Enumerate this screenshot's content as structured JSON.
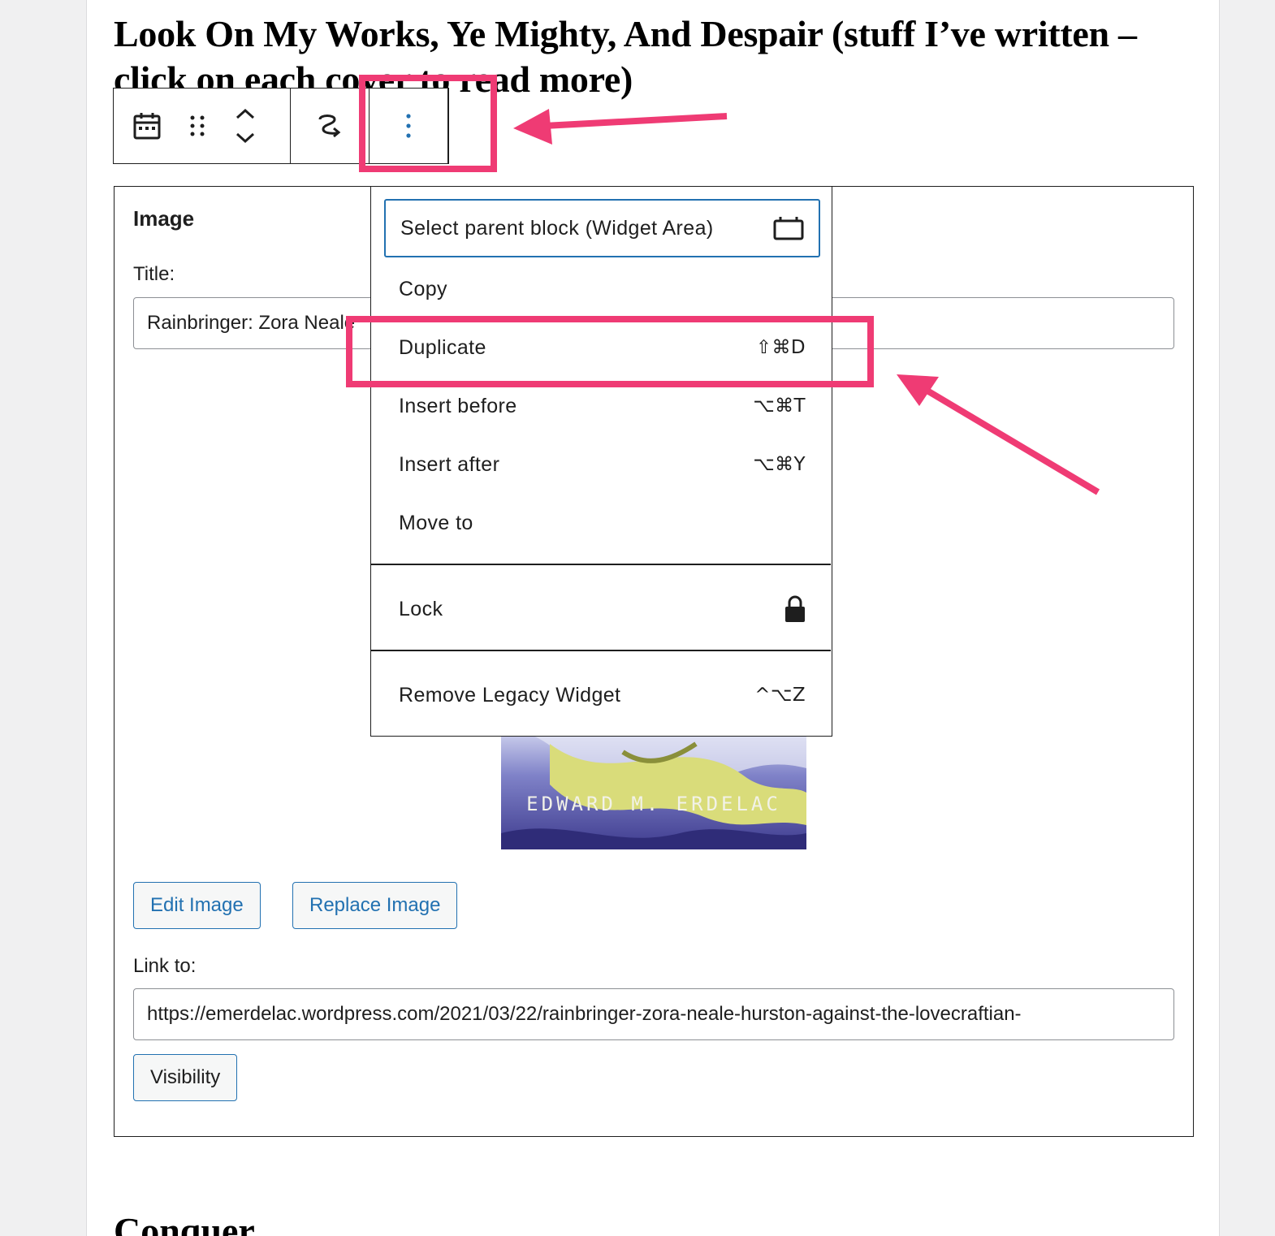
{
  "page": {
    "heading": "Look On My Works, Ye Mighty, And Despair (stuff I’ve written – click on each cover to read more)",
    "next_heading": "Conquer"
  },
  "toolbar": {
    "icons": [
      "calendar-icon",
      "drag-handle-icon",
      "move-up-icon",
      "move-down-icon",
      "transform-icon",
      "options-icon"
    ]
  },
  "widget": {
    "title": "Image",
    "title_label": "Title:",
    "title_value": "Rainbringer: Zora Neale",
    "cover_author": "EDWARD M. ERDELAC",
    "edit_button": "Edit Image",
    "replace_button": "Replace Image",
    "link_label": "Link to:",
    "link_value": "https://emerdelac.wordpress.com/2021/03/22/rainbringer-zora-neale-hurston-against-the-lovecraftian-",
    "visibility_button": "Visibility"
  },
  "menu": {
    "select_parent": "Select parent block (Widget Area)",
    "copy": "Copy",
    "duplicate": "Duplicate",
    "duplicate_shortcut": "⇧⌘D",
    "insert_before": "Insert before",
    "insert_before_shortcut": "⌥⌘T",
    "insert_after": "Insert after",
    "insert_after_shortcut": "⌥⌘Y",
    "move_to": "Move to",
    "lock": "Lock",
    "remove": "Remove Legacy Widget",
    "remove_shortcut": "^⌥Z"
  },
  "colors": {
    "accent": "#2271b1",
    "annotation": "#ef3b74",
    "text": "#1e1e1e"
  }
}
